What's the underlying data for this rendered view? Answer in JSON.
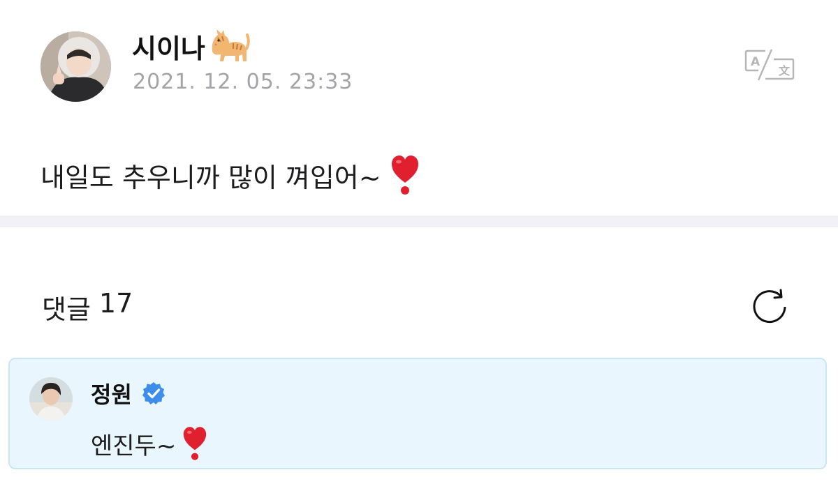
{
  "post": {
    "author": {
      "name": "시이나",
      "emoji_icon": "cat-emoji-icon",
      "avatar_icon": "profile-photo-avatar"
    },
    "timestamp": "2021. 12. 05. 23:33",
    "translate_icon": "translate-icon",
    "body_text": "내일도 추우니까 많이 껴입어~",
    "body_emoji_icon": "red-heart-exclamation-icon"
  },
  "comments": {
    "label": "댓글",
    "count": "17",
    "refresh_icon": "refresh-icon",
    "items": [
      {
        "author": "정원",
        "verified_icon": "verified-badge-icon",
        "text": "엔진두~",
        "emoji_icon": "red-heart-exclamation-icon",
        "highlighted": true
      }
    ]
  },
  "colors": {
    "timestamp": "#a4a4a8",
    "separator": "#f2f2f6",
    "comment_highlight_bg": "#e9f6fd",
    "comment_highlight_border": "#c9e6f2",
    "verified_blue": "#3d8eea",
    "heart_red": "#e0202e"
  }
}
